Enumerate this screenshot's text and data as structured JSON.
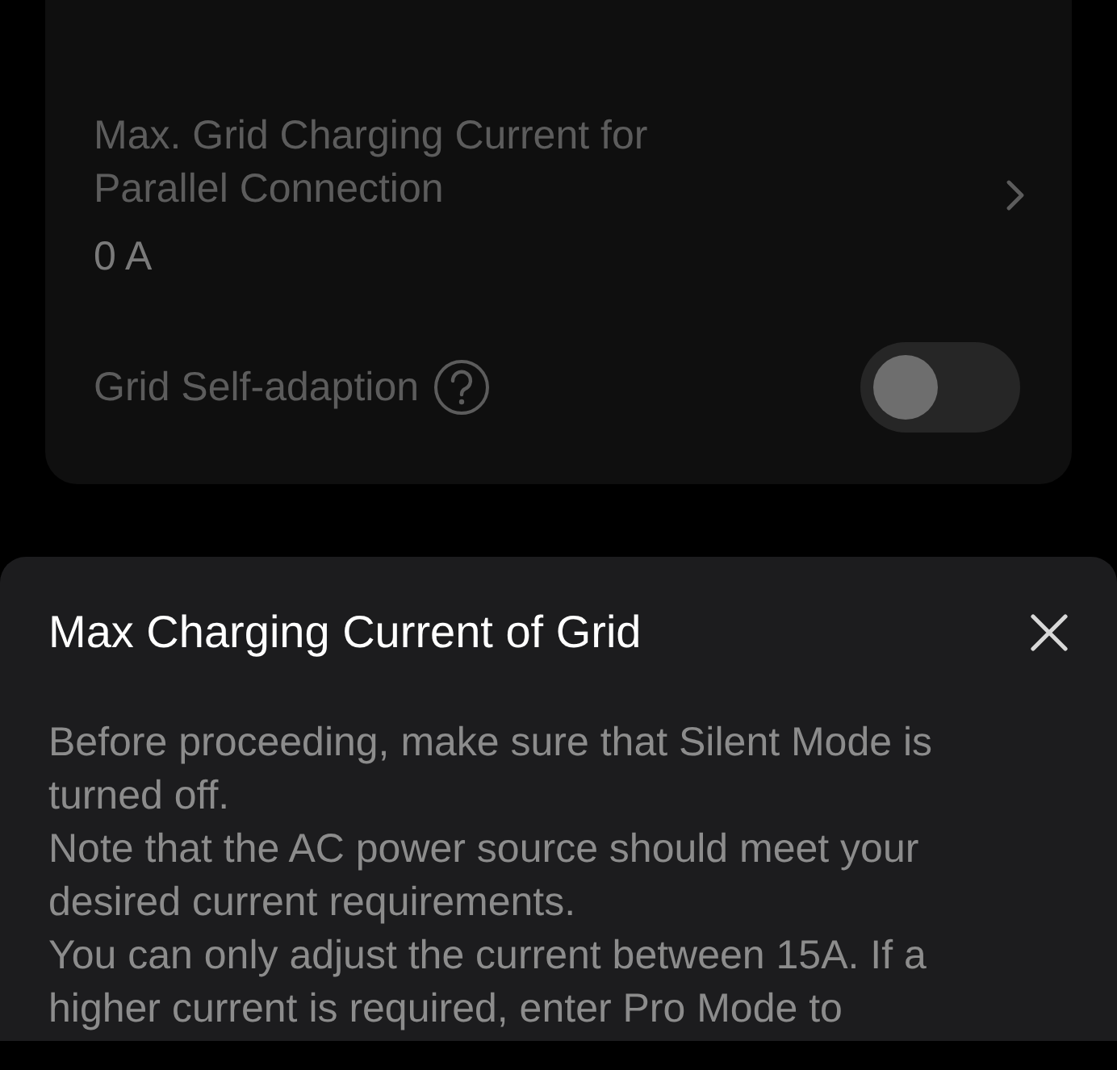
{
  "settings_card": {
    "rows": [
      {
        "kind": "link",
        "label": "Max. Grid Charging Current for Parallel Connection",
        "value": "0 A"
      },
      {
        "kind": "toggle",
        "label": "Grid Self-adaption",
        "help": true,
        "on": false
      }
    ]
  },
  "dialog": {
    "title": "Max Charging Current of Grid",
    "paragraphs": [
      "Before proceeding, make sure that Silent Mode is turned off.",
      "Note that the AC power source should meet your desired current requirements.",
      "You can only adjust the current between 15A. If a higher current is required, enter Pro Mode to"
    ]
  }
}
